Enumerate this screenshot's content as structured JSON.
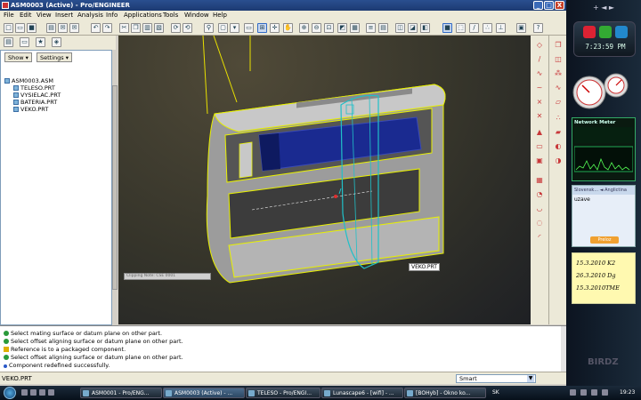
{
  "window": {
    "title": "ASM0003 (Active) - Pro/ENGINEER",
    "min": "_",
    "max": "□",
    "close": "X"
  },
  "menu": [
    "File",
    "Edit",
    "View",
    "Insert",
    "Analysis",
    "Info",
    "Applications",
    "Tools",
    "Window",
    "Help"
  ],
  "tree": {
    "show_label": "Show ▾",
    "settings_label": "Settings ▾",
    "nodes": [
      "ASM0003.ASM",
      "TELESO.PRT",
      "VYSIELAC.PRT",
      "BATERIA.PRT",
      "VEKO.PRT"
    ]
  },
  "viewport": {
    "part_label": "VEKO.PRT",
    "clip_label": "Clipping Note: CSE 0001"
  },
  "messages": [
    {
      "icon": "ok",
      "text": "Select mating surface or datum plane on other part."
    },
    {
      "icon": "ok",
      "text": "Select offset aligning surface or datum plane on other part."
    },
    {
      "icon": "warn",
      "text": "Reference is to a packaged component."
    },
    {
      "icon": "ok",
      "text": "Select offset aligning surface or datum plane on other part."
    },
    {
      "icon": "info",
      "text": "Component redefined successfully."
    }
  ],
  "status": {
    "text": "VEKO.PRT",
    "filter": "Smart"
  },
  "sidebar": {
    "top_label": "+ ◄ ►",
    "clock": "7:23:59 PM",
    "network_meter": {
      "title": "Network Meter"
    },
    "translator": {
      "header": "Slovensk... ◄ Anglictina",
      "word": "uzave",
      "button": "Preloz"
    },
    "notes": [
      "15.3.2010 K2",
      "26.3.2010 Dg",
      "15.3.2010TME"
    ],
    "logo": "BIRDZ"
  },
  "taskbar": {
    "tasks": [
      "ASM0001 - Pro/ENG...",
      "ASM0003 (Active) - ...",
      "TELESO - Pro/ENGI...",
      "Lunascape6 - [wifi] - ...",
      "[BOHyb] - Okno ko..."
    ],
    "lang": "SK",
    "clock": "19:23"
  },
  "colors": {
    "accent": "#316ac5",
    "highlight": "#e8f000",
    "model_blue": "#1a2a90",
    "model_gray": "#b8b8b8",
    "selection": "#20c0c8"
  }
}
